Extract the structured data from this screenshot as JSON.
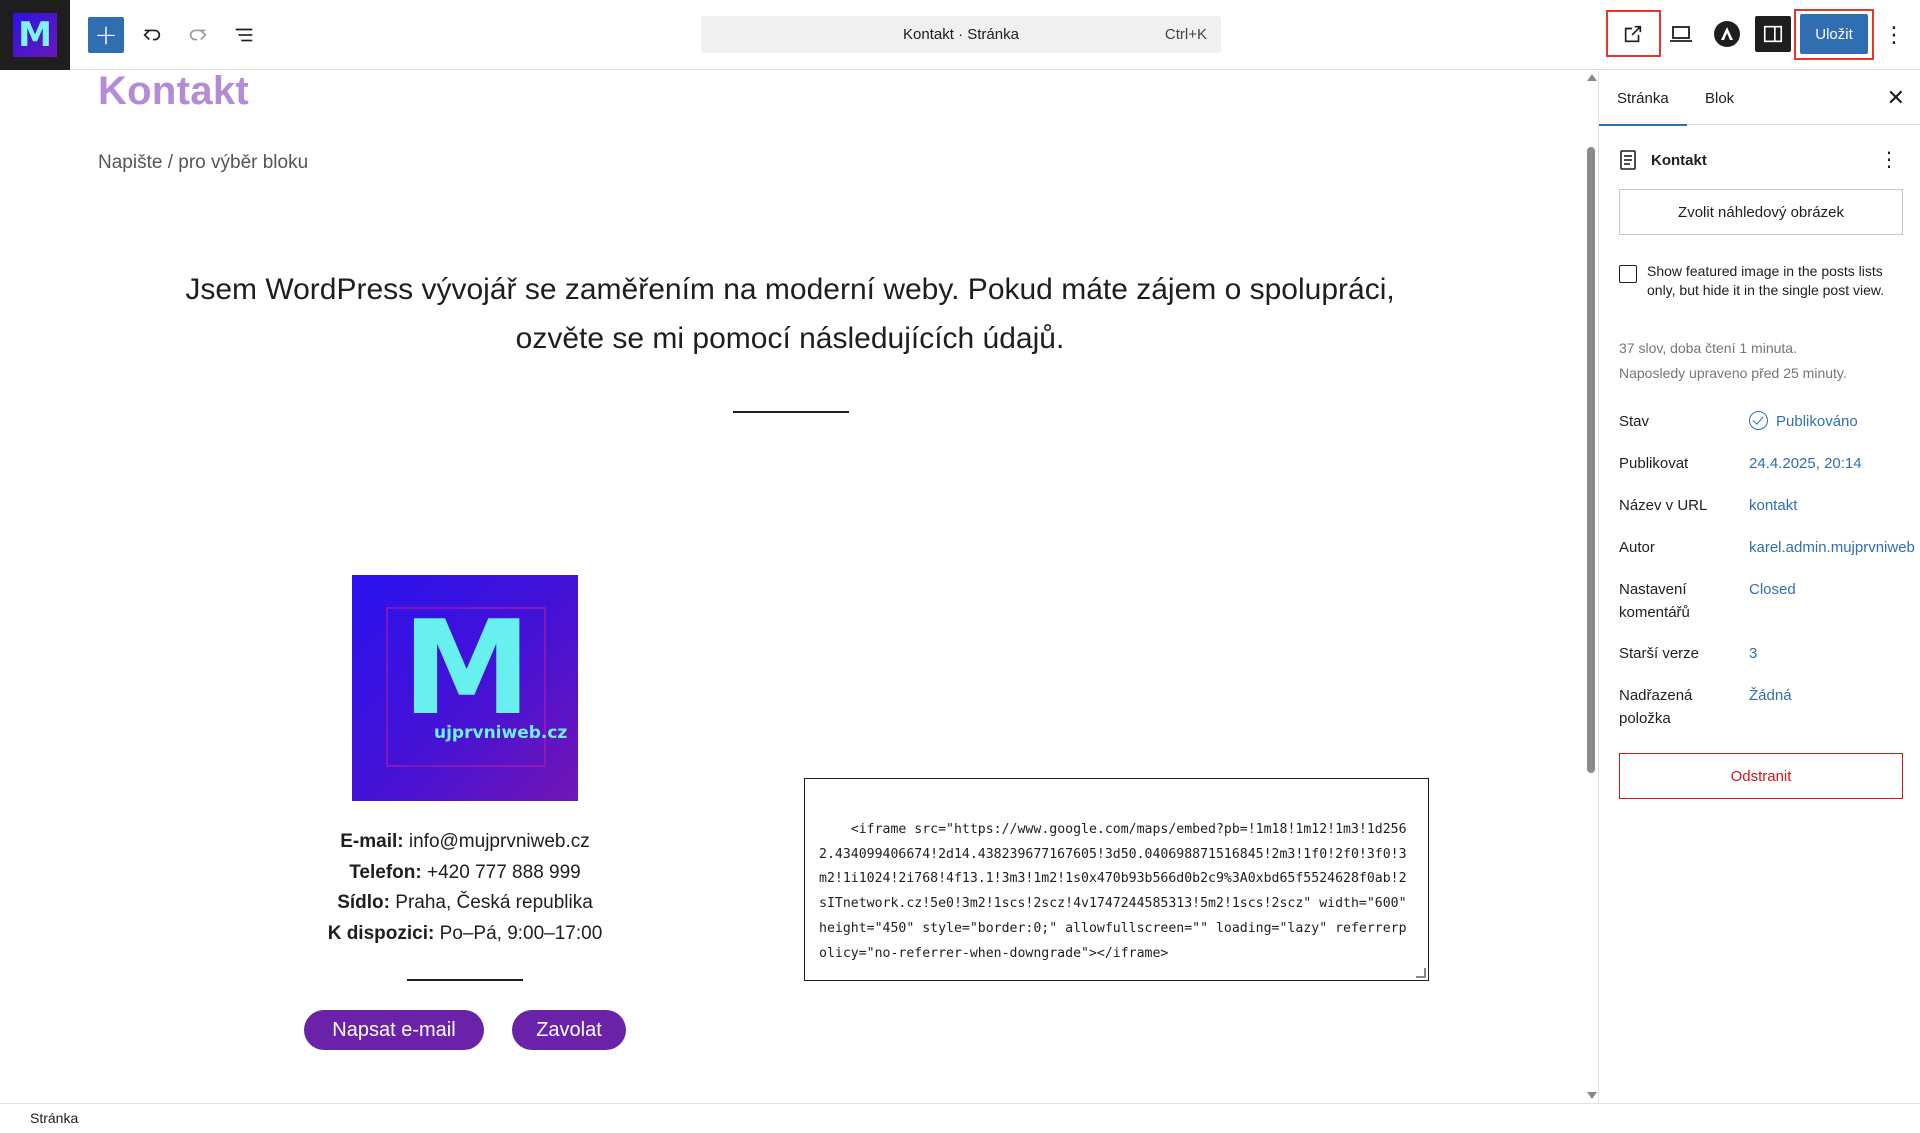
{
  "app": {
    "logo_letter": "M"
  },
  "toolbar": {
    "add_icon": "plus-icon",
    "undo_icon": "undo-icon",
    "redo_icon": "redo-icon",
    "list_view_icon": "list-view-icon",
    "document_title": "Kontakt · Stránka",
    "shortcut": "Ctrl+K",
    "view_icon": "external-link-icon",
    "preview_icon": "desktop-preview-icon",
    "astra_icon": "astra-logo-icon",
    "settings_icon": "sidebar-toggle-icon",
    "save_label": "Uložit",
    "options_icon": "kebab-menu-icon",
    "accent_color": "#2f6fb1",
    "highlight_color": "#e5372a"
  },
  "canvas": {
    "page_title": "Kontakt",
    "placeholder": "Napište / pro výběr bloku",
    "intro_text": "Jsem WordPress vývojář se zaměřením na moderní weby. Pokud máte zájem o spolupráci, ozvěte se mi pomocí následujících údajů.",
    "logo": {
      "letter": "M",
      "text": "ujprvniweb.cz"
    },
    "contact": {
      "email_label": "E-mail:",
      "email_value": "info@mujprvniweb.cz",
      "phone_label": "Telefon:",
      "phone_value": "+420 777 888 999",
      "seat_label": "Sídlo:",
      "seat_value": "Praha, Česká republika",
      "availability_label": "K dispozici:",
      "availability_value": "Po–Pá, 9:00–17:00"
    },
    "buttons": {
      "email": "Napsat e-mail",
      "call": "Zavolat"
    },
    "code": "<iframe src=\"https://www.google.com/maps/embed?pb=!1m18!1m12!1m3!1d2562.434099406674!2d14.438239677167605!3d50.040698871516845!2m3!1f0!2f0!3f0!3m2!1i1024!2i768!4f13.1!3m3!1m2!1s0x470b93b566d0b2c9%3A0xbd65f5524628f0ab!2sITnetwork.cz!5e0!3m2!1scs!2scz!4v1747244585313!5m2!1scs!2scz\" width=\"600\" height=\"450\" style=\"border:0;\" allowfullscreen=\"\" loading=\"lazy\" referrerpolicy=\"no-referrer-when-downgrade\"></iframe>",
    "pill_color": "#6a22a8",
    "title_color": "#b48cd6"
  },
  "sidebar": {
    "tabs": [
      {
        "label": "Stránka"
      },
      {
        "label": "Blok"
      }
    ],
    "close_icon": "close-icon",
    "document_icon": "page-icon",
    "document_name": "Kontakt",
    "featured_image_button": "Zvolit náhledový obrázek",
    "featured_checkbox_label": "Show featured image in the posts lists only, but hide it in the single post view.",
    "word_count": "37 slov, doba čtení 1 minuta.",
    "last_edited": "Naposledy upraveno před 25 minuty.",
    "fields": [
      {
        "label": "Stav",
        "value": "Publikováno"
      },
      {
        "label": "Publikovat",
        "value": "24.4.2025, 20:14"
      },
      {
        "label": "Název v URL",
        "value": "kontakt"
      },
      {
        "label": "Autor",
        "value": "karel.admin.mujprvniweb"
      },
      {
        "label": "Nastavení komentářů",
        "value": "Closed"
      },
      {
        "label": "Starší verze",
        "value": "3"
      },
      {
        "label": "Nadřazená položka",
        "value": "Žádná"
      }
    ],
    "delete_button": "Odstranit",
    "danger_color": "#cc1818"
  },
  "footer": {
    "breadcrumb": "Stránka"
  }
}
